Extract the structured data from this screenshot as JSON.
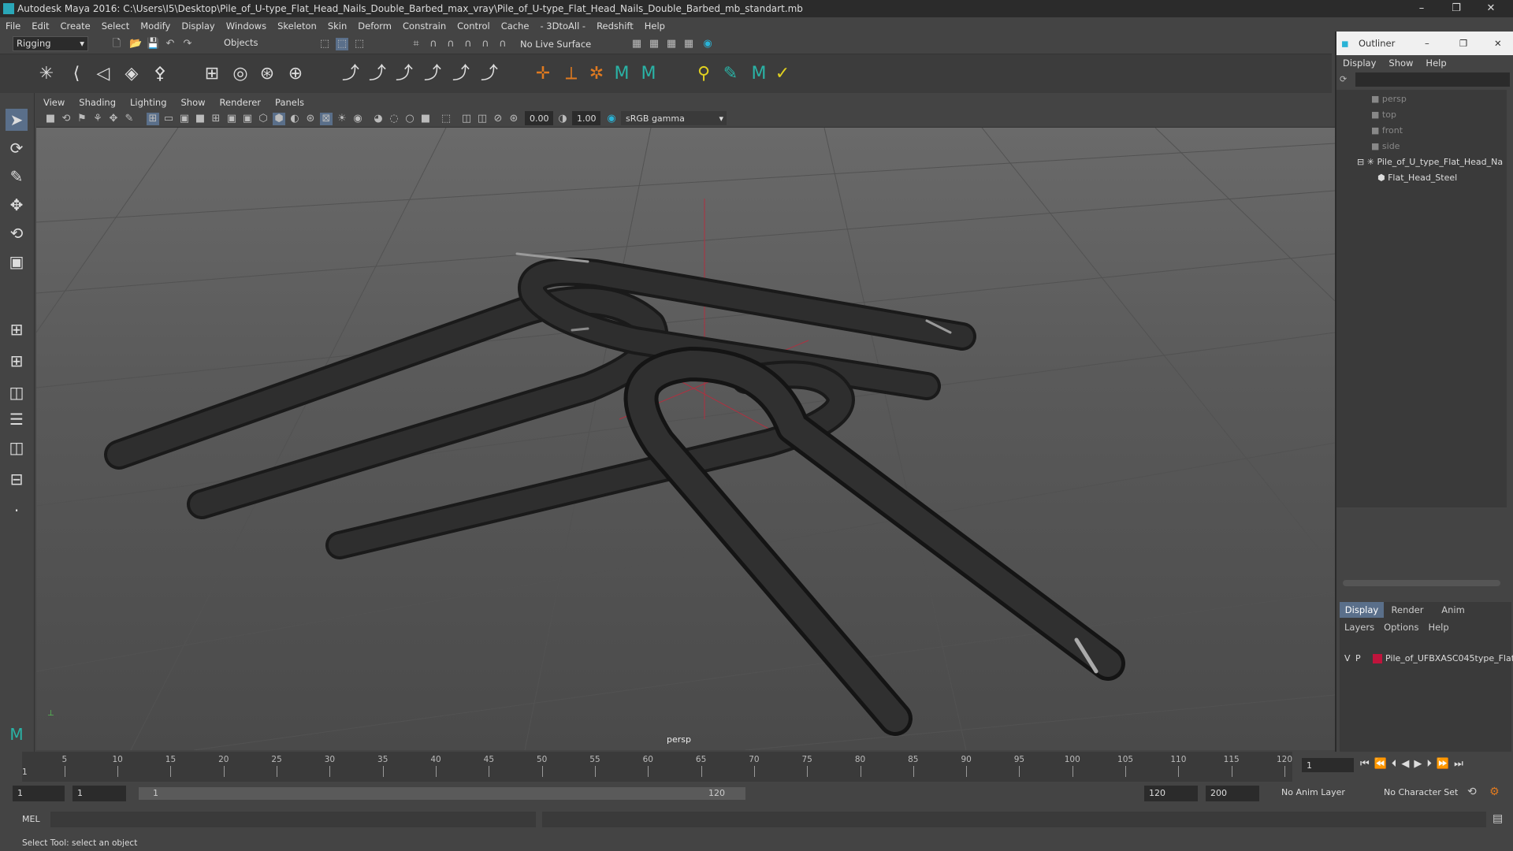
{
  "window": {
    "title": "Autodesk Maya 2016: C:\\Users\\I5\\Desktop\\Pile_of_U-type_Flat_Head_Nails_Double_Barbed_max_vray\\Pile_of_U-type_Flat_Head_Nails_Double_Barbed_mb_standart.mb",
    "minimize": "–",
    "restore": "❐",
    "close": "✕"
  },
  "menu": [
    "File",
    "Edit",
    "Create",
    "Select",
    "Modify",
    "Display",
    "Windows",
    "Skeleton",
    "Skin",
    "Deform",
    "Constrain",
    "Control",
    "Cache",
    "- 3DtoAll -",
    "Redshift",
    "Help"
  ],
  "statusline": {
    "menuset": "Rigging",
    "selection_mode": "Objects",
    "live_surface": "No Live Surface"
  },
  "panel": {
    "menu": [
      "View",
      "Shading",
      "Lighting",
      "Show",
      "Renderer",
      "Panels"
    ],
    "exposure": "0.00",
    "gamma": "1.00",
    "color_space": "sRGB gamma",
    "camera_label": "persp"
  },
  "outliner": {
    "title": "Outliner",
    "menu": [
      "Display",
      "Show",
      "Help"
    ],
    "items": [
      {
        "label": "persp",
        "type": "camera"
      },
      {
        "label": "top",
        "type": "camera"
      },
      {
        "label": "front",
        "type": "camera"
      },
      {
        "label": "side",
        "type": "camera"
      },
      {
        "label": "Pile_of_U_type_Flat_Head_Na",
        "type": "group"
      },
      {
        "label": "Flat_Head_Steel",
        "type": "mesh"
      }
    ]
  },
  "layers": {
    "tabs": [
      "Display",
      "Render",
      "Anim"
    ],
    "menu": [
      "Layers",
      "Options",
      "Help"
    ],
    "rows": [
      {
        "v": "V",
        "p": "P",
        "color": "#c0143c",
        "name": "Pile_of_UFBXASC045type_Flat"
      }
    ]
  },
  "timeslider": {
    "ticks": [
      5,
      10,
      15,
      20,
      25,
      30,
      35,
      40,
      45,
      50,
      55,
      60,
      65,
      70,
      75,
      80,
      85,
      90,
      95,
      100,
      105,
      110,
      115,
      120
    ],
    "start_label": "1",
    "current_frame": "1"
  },
  "range": {
    "start": "1",
    "playback_start": "1",
    "range_start_label": "1",
    "range_end_label": "120",
    "playback_end": "120",
    "end": "200",
    "anim_layer": "No Anim Layer",
    "character_set": "No Character Set"
  },
  "cmdline": {
    "label": "MEL"
  },
  "helpline": {
    "text": "Select Tool: select an object"
  }
}
